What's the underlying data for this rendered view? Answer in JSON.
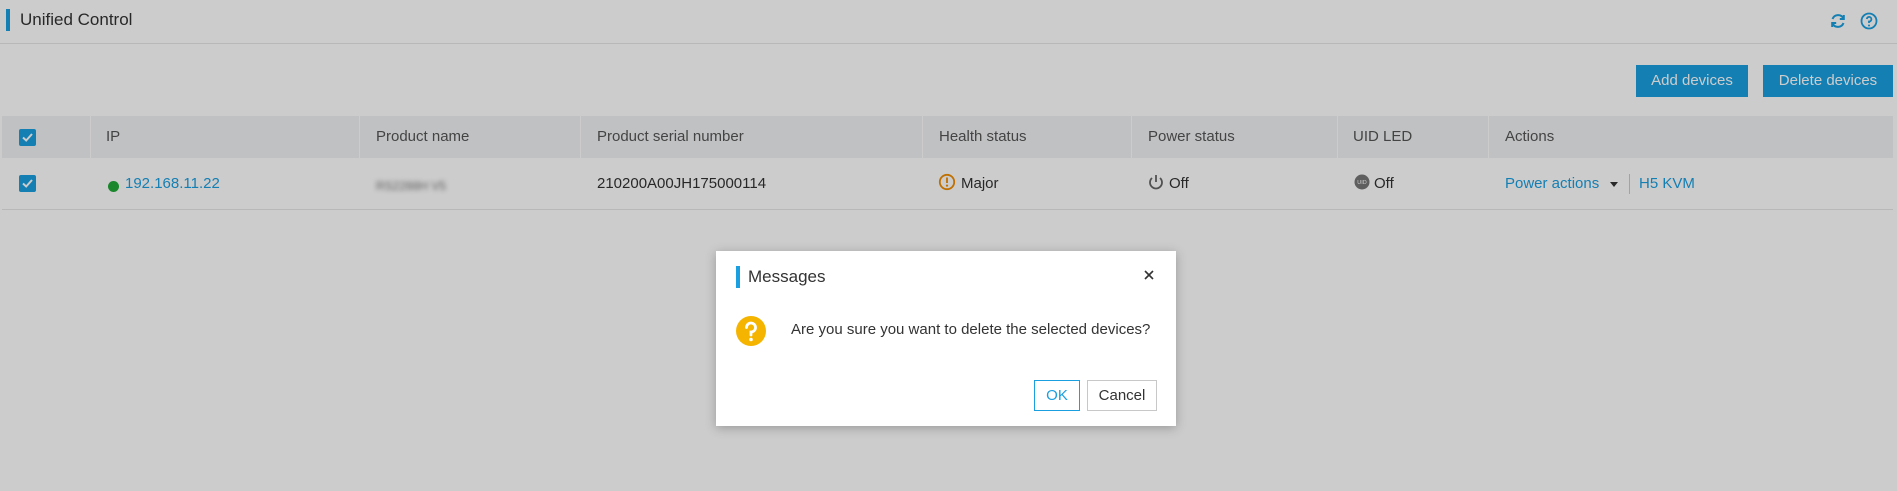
{
  "header": {
    "title": "Unified Control",
    "icons": [
      "refresh-icon",
      "help-icon"
    ]
  },
  "toolbar": {
    "add_label": "Add devices",
    "delete_label": "Delete devices"
  },
  "table": {
    "columns": [
      "IP",
      "Product name",
      "Product serial number",
      "Health status",
      "Power status",
      "UID LED",
      "Actions"
    ],
    "rows": [
      {
        "selected": true,
        "ip": "192.168.11.22",
        "ip_status_color": "#21a938",
        "product_name": "RS2288H V5",
        "serial": "210200A00JH175000114",
        "health": "Major",
        "health_color": "#f08c00",
        "power": "Off",
        "uid_led": "Off",
        "actions": {
          "power_actions": "Power actions",
          "kvm": "H5 KVM"
        }
      }
    ]
  },
  "dialog": {
    "title": "Messages",
    "message": "Are you sure you want to delete the selected devices?",
    "ok_label": "OK",
    "cancel_label": "Cancel",
    "icon": "question-icon",
    "icon_color": "#f5b400"
  },
  "colors": {
    "accent": "#1a9fe0",
    "header_bg": "#f1f2f4",
    "overlay": "rgba(0,0,0,0.2)"
  }
}
